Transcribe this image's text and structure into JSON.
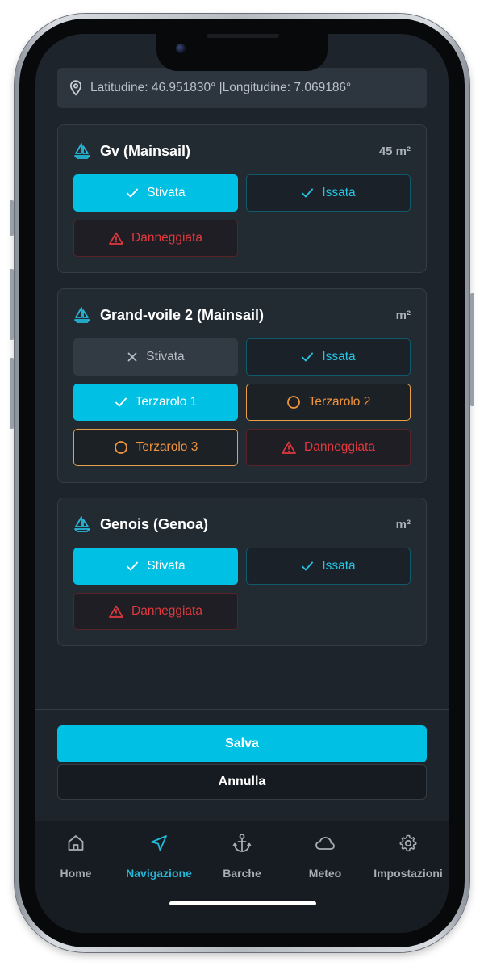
{
  "location": {
    "icon": "map-pin-icon",
    "text": "Latitudine: 46.951830° |Longitudine: 7.069186°"
  },
  "sails": [
    {
      "name": "Gv (Mainsail)",
      "area": "45 m²",
      "buttons": [
        {
          "label": "Stivata",
          "icon": "check-icon",
          "style": "selected"
        },
        {
          "label": "Issata",
          "icon": "check-icon",
          "style": "outline-cyan"
        },
        {
          "label": "Danneggiata",
          "icon": "warning-icon",
          "style": "danger"
        }
      ]
    },
    {
      "name": "Grand-voile 2 (Mainsail)",
      "area": "m²",
      "buttons": [
        {
          "label": "Stivata",
          "icon": "x-icon",
          "style": "muted"
        },
        {
          "label": "Issata",
          "icon": "check-icon",
          "style": "outline-cyan"
        },
        {
          "label": "Terzarolo 1",
          "icon": "check-icon",
          "style": "selected"
        },
        {
          "label": "Terzarolo 2",
          "icon": "circle-icon",
          "style": "outline-orange"
        },
        {
          "label": "Terzarolo 3",
          "icon": "circle-icon",
          "style": "outline-orange"
        },
        {
          "label": "Danneggiata",
          "icon": "warning-icon",
          "style": "danger"
        }
      ]
    },
    {
      "name": "Genois (Genoa)",
      "area": "m²",
      "buttons": [
        {
          "label": "Stivata",
          "icon": "check-icon",
          "style": "selected"
        },
        {
          "label": "Issata",
          "icon": "check-icon",
          "style": "outline-cyan"
        },
        {
          "label": "Danneggiata",
          "icon": "warning-icon",
          "style": "danger"
        }
      ]
    }
  ],
  "actions": {
    "save_label": "Salva",
    "cancel_label": "Annulla"
  },
  "tabs": [
    {
      "label": "Home",
      "icon": "home-icon",
      "active": false
    },
    {
      "label": "Navigazione",
      "icon": "navigation-icon",
      "active": true
    },
    {
      "label": "Barche",
      "icon": "anchor-icon",
      "active": false
    },
    {
      "label": "Meteo",
      "icon": "cloud-icon",
      "active": false
    },
    {
      "label": "Impostazioni",
      "icon": "gear-icon",
      "active": false
    }
  ],
  "colors": {
    "accent": "#00c0e3",
    "danger": "#e0393e",
    "warning": "#f0943f",
    "background": "#1e242b"
  }
}
